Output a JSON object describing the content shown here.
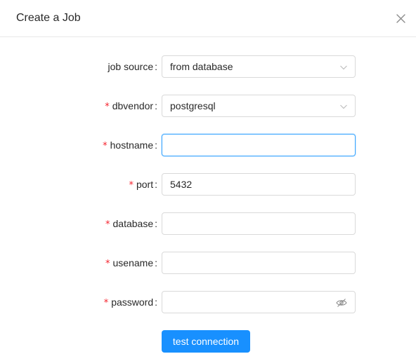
{
  "modal": {
    "title": "Create a Job",
    "close_icon": "close-icon"
  },
  "form": {
    "fields": [
      {
        "key": "job_source",
        "label": "job source",
        "required": false,
        "type": "select",
        "value": "from database"
      },
      {
        "key": "dbvendor",
        "label": "dbvendor",
        "required": true,
        "type": "select",
        "value": "postgresql"
      },
      {
        "key": "hostname",
        "label": "hostname",
        "required": true,
        "type": "input",
        "value": "",
        "focused": true
      },
      {
        "key": "port",
        "label": "port",
        "required": true,
        "type": "input",
        "value": "5432"
      },
      {
        "key": "database",
        "label": "database",
        "required": true,
        "type": "input",
        "value": ""
      },
      {
        "key": "usename",
        "label": "usename",
        "required": true,
        "type": "input",
        "value": ""
      },
      {
        "key": "password",
        "label": "password",
        "required": true,
        "type": "password",
        "value": "",
        "icon": "eye-invisible-icon"
      }
    ],
    "required_mark": "*",
    "colon": ":",
    "test_button_label": "test connection"
  },
  "colors": {
    "primary": "#1890ff",
    "required": "#f5222d",
    "focus_border": "#40a9ff",
    "border": "#d9d9d9"
  }
}
